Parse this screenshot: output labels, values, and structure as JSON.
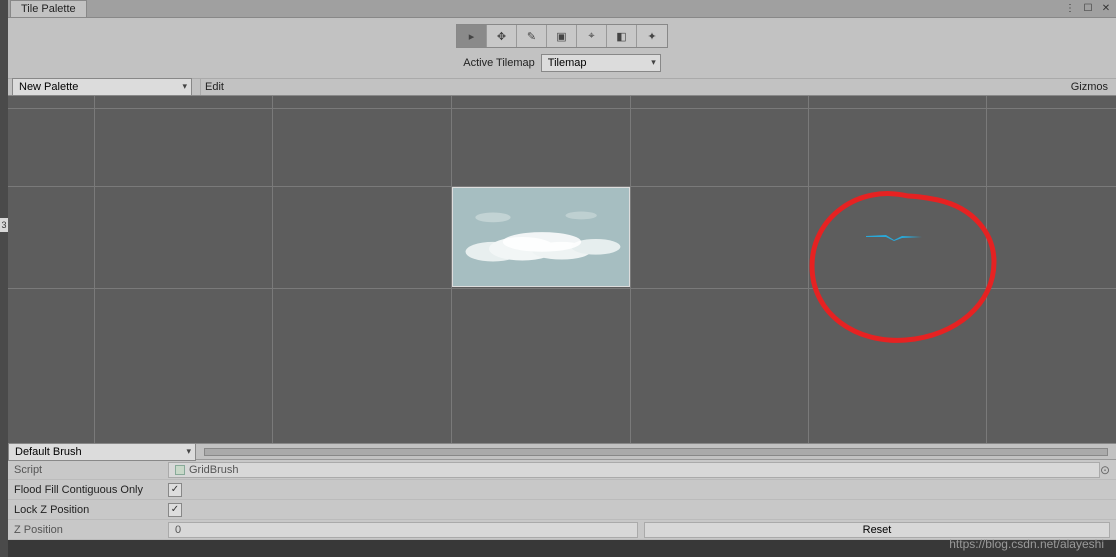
{
  "window": {
    "tab_title": "Tile Palette"
  },
  "toolbar": {
    "tools": [
      "select",
      "move",
      "brush",
      "box",
      "picker",
      "eraser",
      "fill"
    ],
    "active_index": 0,
    "tilemap_label": "Active Tilemap",
    "tilemap_value": "Tilemap"
  },
  "subbar": {
    "palette_value": "New Palette",
    "edit_label": "Edit",
    "gizmos_label": "Gizmos"
  },
  "brush": {
    "dropdown_value": "Default Brush"
  },
  "inspector": {
    "script_label": "Script",
    "script_value": "GridBrush",
    "flood_label": "Flood Fill Contiguous Only",
    "flood_checked": true,
    "lockz_label": "Lock Z Position",
    "lockz_checked": true,
    "zpos_label": "Z Position",
    "zpos_value": "0",
    "reset_label": "Reset"
  },
  "icons": {
    "select": "▸",
    "move": "✥",
    "brush": "✎",
    "box": "▣",
    "picker": "⌖",
    "eraser": "◧",
    "fill": "✦",
    "check": "✓",
    "gear": "⊙",
    "menu": "⋮",
    "max": "☐",
    "close": "✕"
  },
  "watermark": "https://blog.csdn.net/alayeshi",
  "left_badge": "3"
}
